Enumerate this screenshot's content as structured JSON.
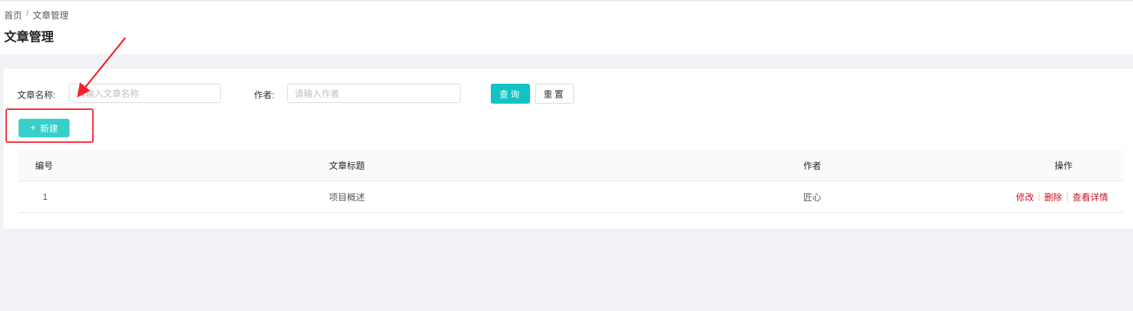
{
  "breadcrumb": {
    "home": "首页",
    "separator": "/",
    "current": "文章管理"
  },
  "page": {
    "title": "文章管理"
  },
  "search": {
    "title_label": "文章名称:",
    "title_placeholder": "请输入文章名称",
    "author_label": "作者:",
    "author_placeholder": "请输入作者",
    "query_button": "查询",
    "reset_button": "重置"
  },
  "toolbar": {
    "new_button": "新建",
    "new_icon": "plus-icon"
  },
  "table": {
    "columns": [
      "编号",
      "文章标题",
      "作者",
      "操作"
    ],
    "rows": [
      {
        "id": "1",
        "title": "项目概述",
        "author": "匠心",
        "actions": [
          "修改",
          "删除",
          "查看详情"
        ]
      }
    ]
  },
  "colors": {
    "primary": "#13c2c2",
    "new_button": "#36cfc9",
    "danger_link": "#cf1322",
    "annotation": "#f5222d"
  }
}
